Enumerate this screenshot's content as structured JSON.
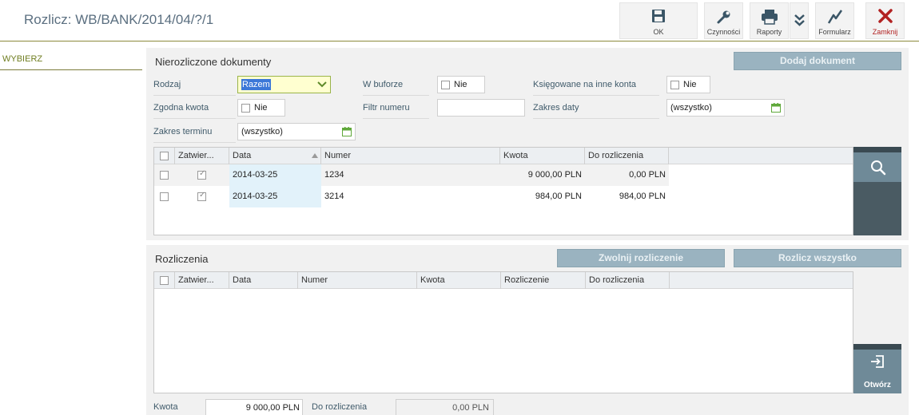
{
  "header": {
    "title": "Rozlicz: WB/BANK/2014/04/?/1",
    "buttons": {
      "ok": "OK",
      "czynnosci": "Czynności",
      "raporty": "Raporty",
      "formularz": "Formularz",
      "zamknij": "Zamknij"
    }
  },
  "nav": {
    "wybierz": "WYBIERZ"
  },
  "unsettled": {
    "title": "Nierozliczone dokumenty",
    "add_button": "Dodaj dokument",
    "filters": {
      "rodzaj_label": "Rodzaj",
      "rodzaj_value": "Razem",
      "w_buforze_label": "W buforze",
      "w_buforze_value": "Nie",
      "ksiegowane_label": "Księgowane na inne konta",
      "ksiegowane_value": "Nie",
      "zgodna_kwota_label": "Zgodna kwota",
      "zgodna_kwota_value": "Nie",
      "filtr_numeru_label": "Filtr numeru",
      "filtr_numeru_value": "",
      "zakres_daty_label": "Zakres daty",
      "zakres_daty_value": "(wszystko)",
      "zakres_terminu_label": "Zakres terminu",
      "zakres_terminu_value": "(wszystko)"
    },
    "columns": [
      "Zatwier...",
      "Data",
      "Numer",
      "Kwota",
      "Do rozliczenia"
    ],
    "rows": [
      {
        "data": "2014-03-25",
        "numer": "1234",
        "kwota": "9 000,00 PLN",
        "do_rozliczenia": "0,00 PLN"
      },
      {
        "data": "2014-03-25",
        "numer": "3214",
        "kwota": "984,00 PLN",
        "do_rozliczenia": "984,00 PLN"
      }
    ]
  },
  "settlements": {
    "title": "Rozliczenia",
    "release_button": "Zwolnij rozliczenie",
    "settle_all_button": "Rozlicz wszystko",
    "columns": [
      "Zatwier...",
      "Data",
      "Numer",
      "Kwota",
      "Rozliczenie",
      "Do rozliczenia"
    ],
    "open_button": "Otwórz"
  },
  "footer": {
    "kwota_label": "Kwota",
    "kwota_value": "9 000,00 PLN",
    "do_rozliczenia_label": "Do rozliczenia",
    "do_rozliczenia_value": "0,00 PLN"
  },
  "colors": {
    "accent_olive": "#6f7d20",
    "close_red": "#b22222",
    "side_panel": "#4a5b63",
    "button_grey": "#9ab3c0"
  }
}
